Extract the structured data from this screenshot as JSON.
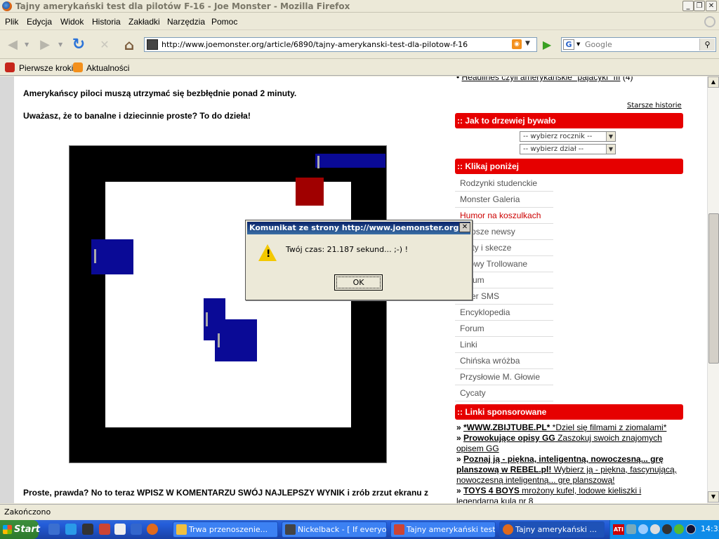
{
  "window": {
    "title": "Tajny amerykański test dla pilotów F-16 - Joe Monster - Mozilla Firefox",
    "minimize_icon": "_",
    "maximize_icon": "❐",
    "close_icon": "✕"
  },
  "menu": [
    "Plik",
    "Edycja",
    "Widok",
    "Historia",
    "Zakładki",
    "Narzędzia",
    "Pomoc"
  ],
  "nav": {
    "url": "http://www.joemonster.org/article/6890/tajny-amerykanski-test-dla-pilotow-f-16",
    "search_placeholder": "Google"
  },
  "bookmarks": [
    "Pierwsze kroki",
    "Aktualności"
  ],
  "article": {
    "para1": "Amerykańscy piloci muszą utrzymać się bezbłędnie ponad 2 minuty.",
    "para2": "Uważasz, że to banalne i dziecinnie proste? To do dzieła!",
    "para3": "Proste, prawda? No to teraz WPISZ W KOMENTARZU SWÓJ NAJLEPSZY WYNIK i zrób zrzut ekranu z"
  },
  "sidebar": {
    "top_link": "Headlines czyli amerykańskie \"pajacyki\" III",
    "top_link_count": "(4)",
    "older_stories": "Starsze historie",
    "header1": ":: Jak to drzewiej bywało",
    "select_year": "-- wybierz rocznik --",
    "select_section": "-- wybierz dział --",
    "header2": ":: Klikaj poniżej",
    "links": [
      "Rodzynki studenckie",
      "Monster Galeria",
      "Humor na koszulkach",
      "Najgłupsze newsy",
      "Kabarety i skecze",
      "Rytmowy Trollowane",
      "Archiwum",
      "Monster SMS",
      "Encyklopedia",
      "Forum",
      "Linki",
      "Chińska wróżba",
      "Przysłowie M. Głowie",
      "Cycaty"
    ],
    "links_visible": [
      "Rodzynki studenckie",
      "Monster Galeria",
      "Humor na koszulkach",
      "głupsze newsy",
      "arety i skecze",
      "tmowy Trollowane",
      "hiwum",
      "nster SMS",
      "Encyklopedia",
      "Forum",
      "Linki",
      "Chińska wróżba",
      "Przysłowie M. Głowie",
      "Cycaty"
    ],
    "highlight_color": "#cc0000",
    "header3": ":: Linki sponsorowane",
    "sponsored": [
      {
        "bold": "*WWW.ZBIJTUBE.PL*",
        "rest": " *Dziel się filmami z ziomalami*"
      },
      {
        "bold": "Prowokujące opisy GG",
        "rest": " Zaszokuj swoich znajomych opisem GG"
      },
      {
        "bold": "Poznaj ją - piękna, inteligentną, nowoczesną... grę planszową w REBEL.pl!",
        "rest": " Wybierz ją - piękna, fascynującą, nowoczesną inteligentną... grę planszową!"
      },
      {
        "bold": "TOYS 4 BOYS",
        "rest": " mrożony kufel, lodowe kieliszki i legendarna kula nr 8"
      }
    ]
  },
  "dialog": {
    "title": "Komunikat ze strony http://www.joemonster.org:",
    "message": "Twój czas: 21.187 sekund... ;-) !",
    "ok": "OK"
  },
  "status": "Zakończono",
  "taskbar": {
    "start": "Start",
    "tasks": [
      "Trwa przenoszenie...",
      "Nickelback - [ If everyo...",
      "Tajny amerykański test...",
      "Tajny amerykański ..."
    ],
    "clock": "14:35"
  },
  "colors": {
    "accent_red": "#e60000",
    "game_blue": "#0a0a96",
    "game_red": "#a00000"
  }
}
